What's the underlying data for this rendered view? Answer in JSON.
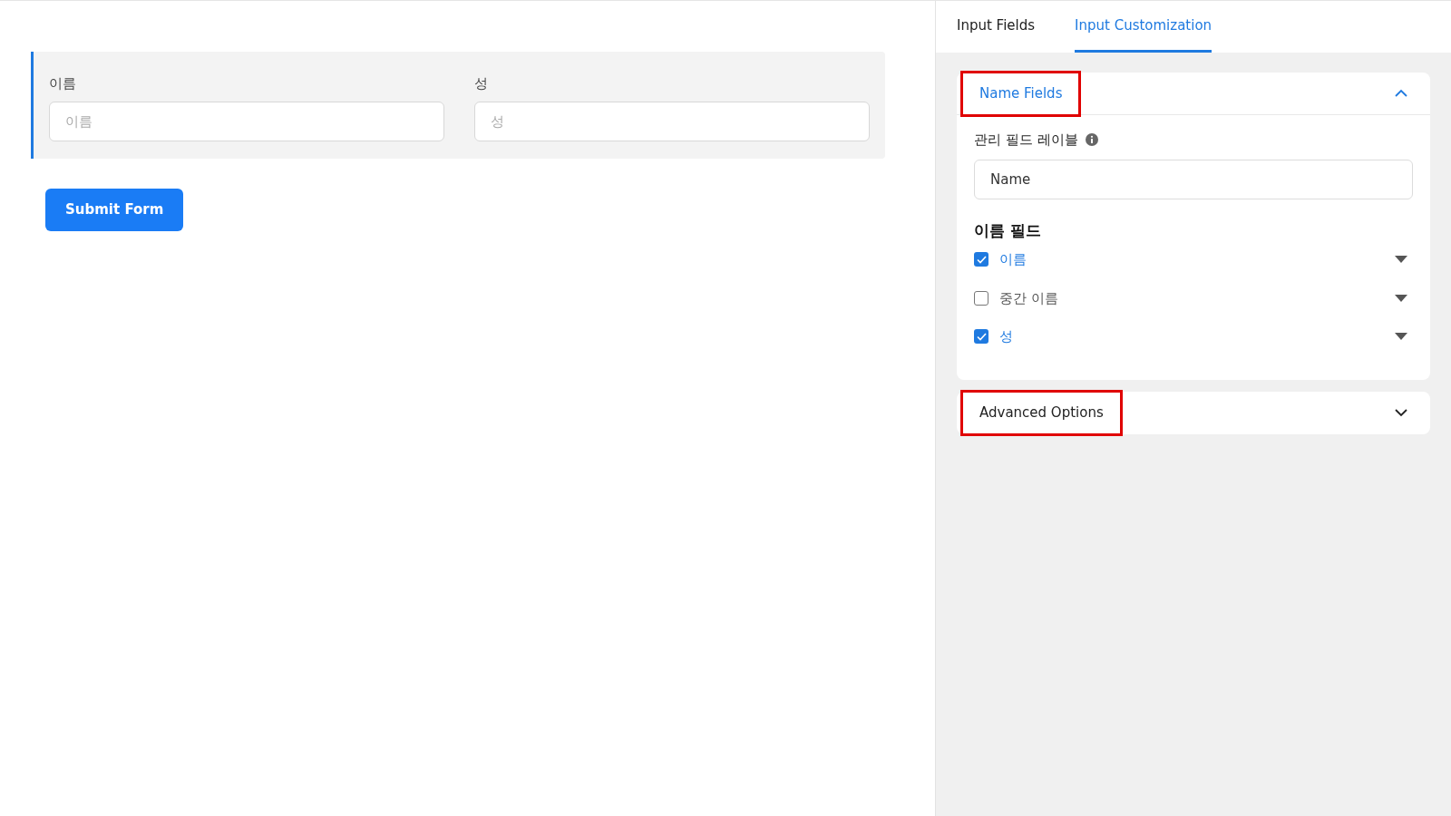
{
  "form": {
    "fields": [
      {
        "label": "이름",
        "placeholder": "이름"
      },
      {
        "label": "성",
        "placeholder": "성"
      }
    ],
    "submit": "Submit Form"
  },
  "panel": {
    "tabs": [
      {
        "label": "Input Fields",
        "selected": false
      },
      {
        "label": "Input Customization",
        "selected": true
      }
    ],
    "sections": [
      {
        "title": "Name Fields",
        "expanded": true,
        "highlighted": true,
        "admin_label": "관리 필드 레이블",
        "admin_value": "Name",
        "group_title": "이름 필드",
        "items": [
          {
            "label": "이름",
            "checked": true
          },
          {
            "label": "중간 이름",
            "checked": false
          },
          {
            "label": "성",
            "checked": true
          }
        ]
      },
      {
        "title": "Advanced Options",
        "expanded": false,
        "highlighted": true
      }
    ]
  }
}
